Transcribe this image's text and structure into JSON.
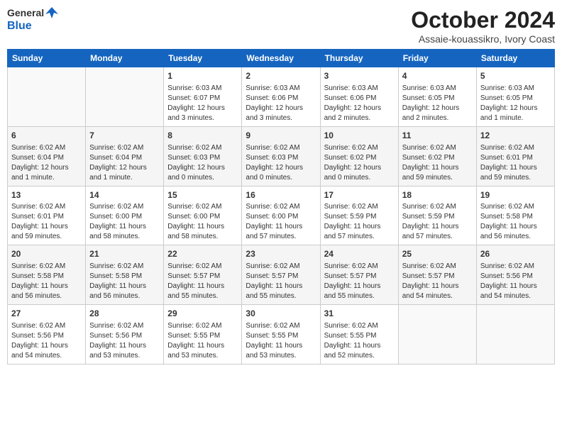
{
  "logo": {
    "general": "General",
    "blue": "Blue"
  },
  "title": "October 2024",
  "location": "Assaie-kouassikro, Ivory Coast",
  "headers": [
    "Sunday",
    "Monday",
    "Tuesday",
    "Wednesday",
    "Thursday",
    "Friday",
    "Saturday"
  ],
  "weeks": [
    [
      {
        "day": "",
        "info": ""
      },
      {
        "day": "",
        "info": ""
      },
      {
        "day": "1",
        "info": "Sunrise: 6:03 AM\nSunset: 6:07 PM\nDaylight: 12 hours and 3 minutes."
      },
      {
        "day": "2",
        "info": "Sunrise: 6:03 AM\nSunset: 6:06 PM\nDaylight: 12 hours and 3 minutes."
      },
      {
        "day": "3",
        "info": "Sunrise: 6:03 AM\nSunset: 6:06 PM\nDaylight: 12 hours and 2 minutes."
      },
      {
        "day": "4",
        "info": "Sunrise: 6:03 AM\nSunset: 6:05 PM\nDaylight: 12 hours and 2 minutes."
      },
      {
        "day": "5",
        "info": "Sunrise: 6:03 AM\nSunset: 6:05 PM\nDaylight: 12 hours and 1 minute."
      }
    ],
    [
      {
        "day": "6",
        "info": "Sunrise: 6:02 AM\nSunset: 6:04 PM\nDaylight: 12 hours and 1 minute."
      },
      {
        "day": "7",
        "info": "Sunrise: 6:02 AM\nSunset: 6:04 PM\nDaylight: 12 hours and 1 minute."
      },
      {
        "day": "8",
        "info": "Sunrise: 6:02 AM\nSunset: 6:03 PM\nDaylight: 12 hours and 0 minutes."
      },
      {
        "day": "9",
        "info": "Sunrise: 6:02 AM\nSunset: 6:03 PM\nDaylight: 12 hours and 0 minutes."
      },
      {
        "day": "10",
        "info": "Sunrise: 6:02 AM\nSunset: 6:02 PM\nDaylight: 12 hours and 0 minutes."
      },
      {
        "day": "11",
        "info": "Sunrise: 6:02 AM\nSunset: 6:02 PM\nDaylight: 11 hours and 59 minutes."
      },
      {
        "day": "12",
        "info": "Sunrise: 6:02 AM\nSunset: 6:01 PM\nDaylight: 11 hours and 59 minutes."
      }
    ],
    [
      {
        "day": "13",
        "info": "Sunrise: 6:02 AM\nSunset: 6:01 PM\nDaylight: 11 hours and 59 minutes."
      },
      {
        "day": "14",
        "info": "Sunrise: 6:02 AM\nSunset: 6:00 PM\nDaylight: 11 hours and 58 minutes."
      },
      {
        "day": "15",
        "info": "Sunrise: 6:02 AM\nSunset: 6:00 PM\nDaylight: 11 hours and 58 minutes."
      },
      {
        "day": "16",
        "info": "Sunrise: 6:02 AM\nSunset: 6:00 PM\nDaylight: 11 hours and 57 minutes."
      },
      {
        "day": "17",
        "info": "Sunrise: 6:02 AM\nSunset: 5:59 PM\nDaylight: 11 hours and 57 minutes."
      },
      {
        "day": "18",
        "info": "Sunrise: 6:02 AM\nSunset: 5:59 PM\nDaylight: 11 hours and 57 minutes."
      },
      {
        "day": "19",
        "info": "Sunrise: 6:02 AM\nSunset: 5:58 PM\nDaylight: 11 hours and 56 minutes."
      }
    ],
    [
      {
        "day": "20",
        "info": "Sunrise: 6:02 AM\nSunset: 5:58 PM\nDaylight: 11 hours and 56 minutes."
      },
      {
        "day": "21",
        "info": "Sunrise: 6:02 AM\nSunset: 5:58 PM\nDaylight: 11 hours and 56 minutes."
      },
      {
        "day": "22",
        "info": "Sunrise: 6:02 AM\nSunset: 5:57 PM\nDaylight: 11 hours and 55 minutes."
      },
      {
        "day": "23",
        "info": "Sunrise: 6:02 AM\nSunset: 5:57 PM\nDaylight: 11 hours and 55 minutes."
      },
      {
        "day": "24",
        "info": "Sunrise: 6:02 AM\nSunset: 5:57 PM\nDaylight: 11 hours and 55 minutes."
      },
      {
        "day": "25",
        "info": "Sunrise: 6:02 AM\nSunset: 5:57 PM\nDaylight: 11 hours and 54 minutes."
      },
      {
        "day": "26",
        "info": "Sunrise: 6:02 AM\nSunset: 5:56 PM\nDaylight: 11 hours and 54 minutes."
      }
    ],
    [
      {
        "day": "27",
        "info": "Sunrise: 6:02 AM\nSunset: 5:56 PM\nDaylight: 11 hours and 54 minutes."
      },
      {
        "day": "28",
        "info": "Sunrise: 6:02 AM\nSunset: 5:56 PM\nDaylight: 11 hours and 53 minutes."
      },
      {
        "day": "29",
        "info": "Sunrise: 6:02 AM\nSunset: 5:55 PM\nDaylight: 11 hours and 53 minutes."
      },
      {
        "day": "30",
        "info": "Sunrise: 6:02 AM\nSunset: 5:55 PM\nDaylight: 11 hours and 53 minutes."
      },
      {
        "day": "31",
        "info": "Sunrise: 6:02 AM\nSunset: 5:55 PM\nDaylight: 11 hours and 52 minutes."
      },
      {
        "day": "",
        "info": ""
      },
      {
        "day": "",
        "info": ""
      }
    ]
  ]
}
